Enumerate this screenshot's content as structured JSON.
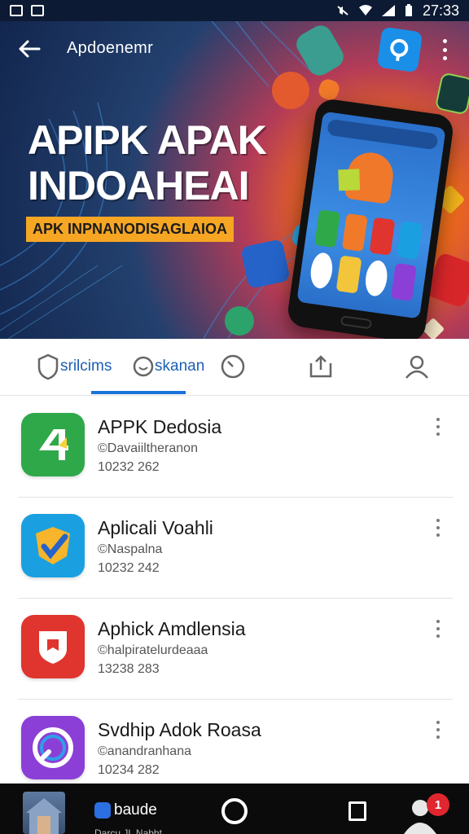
{
  "status_bar": {
    "time": "27:33",
    "icons": [
      "notification-icon",
      "notification-icon",
      "mute-icon",
      "wifi-icon",
      "signal-icon",
      "battery-icon"
    ]
  },
  "app_bar": {
    "title": "Aрdoenemr",
    "back_icon": "back-arrow-icon",
    "search_icon": "search-icon",
    "menu_icon": "more-vertical-icon"
  },
  "banner": {
    "headline_line1": "APIPK APAK",
    "headline_line2": "INDOAHEAI",
    "subheadline": "APK INPNANODISAGLAIOA",
    "colors": {
      "accent": "#f6a623",
      "background": "#12264e"
    }
  },
  "tabs": [
    {
      "label": "srilcims",
      "icon": "shield-icon"
    },
    {
      "label": "skanan",
      "icon": "scan-icon"
    },
    {
      "label": "",
      "icon": "clock-icon"
    },
    {
      "label": "",
      "icon": "share-icon"
    },
    {
      "label": "",
      "icon": "user-icon"
    }
  ],
  "apps": [
    {
      "name": "APPK Dedosia",
      "developer": "©Davaiiltheranon",
      "meta": "10232 262",
      "icon": "android-icon",
      "color": "#2fa84a"
    },
    {
      "name": "Aplicali Voahli",
      "developer": "©Naspalna",
      "meta": "10232 242",
      "icon": "shield-check-icon",
      "color": "#1aa0e0"
    },
    {
      "name": "Aphick Amdlensia",
      "developer": "©halpiratelurdeaaa",
      "meta": "13238 283",
      "icon": "shield-icon",
      "color": "#e0342e"
    },
    {
      "name": "Svdhip Adok Roasa",
      "developer": "©anandranhana",
      "meta": "10234 282",
      "icon": "search-circle-icon",
      "color": "#8b3fd6"
    }
  ],
  "bottom_nav": {
    "account_label": "baude",
    "account_sub": "Darcu JL Nabht",
    "badge_count": "1",
    "icons": [
      "avatar",
      "home-icon",
      "recents-icon",
      "profile-icon"
    ]
  }
}
